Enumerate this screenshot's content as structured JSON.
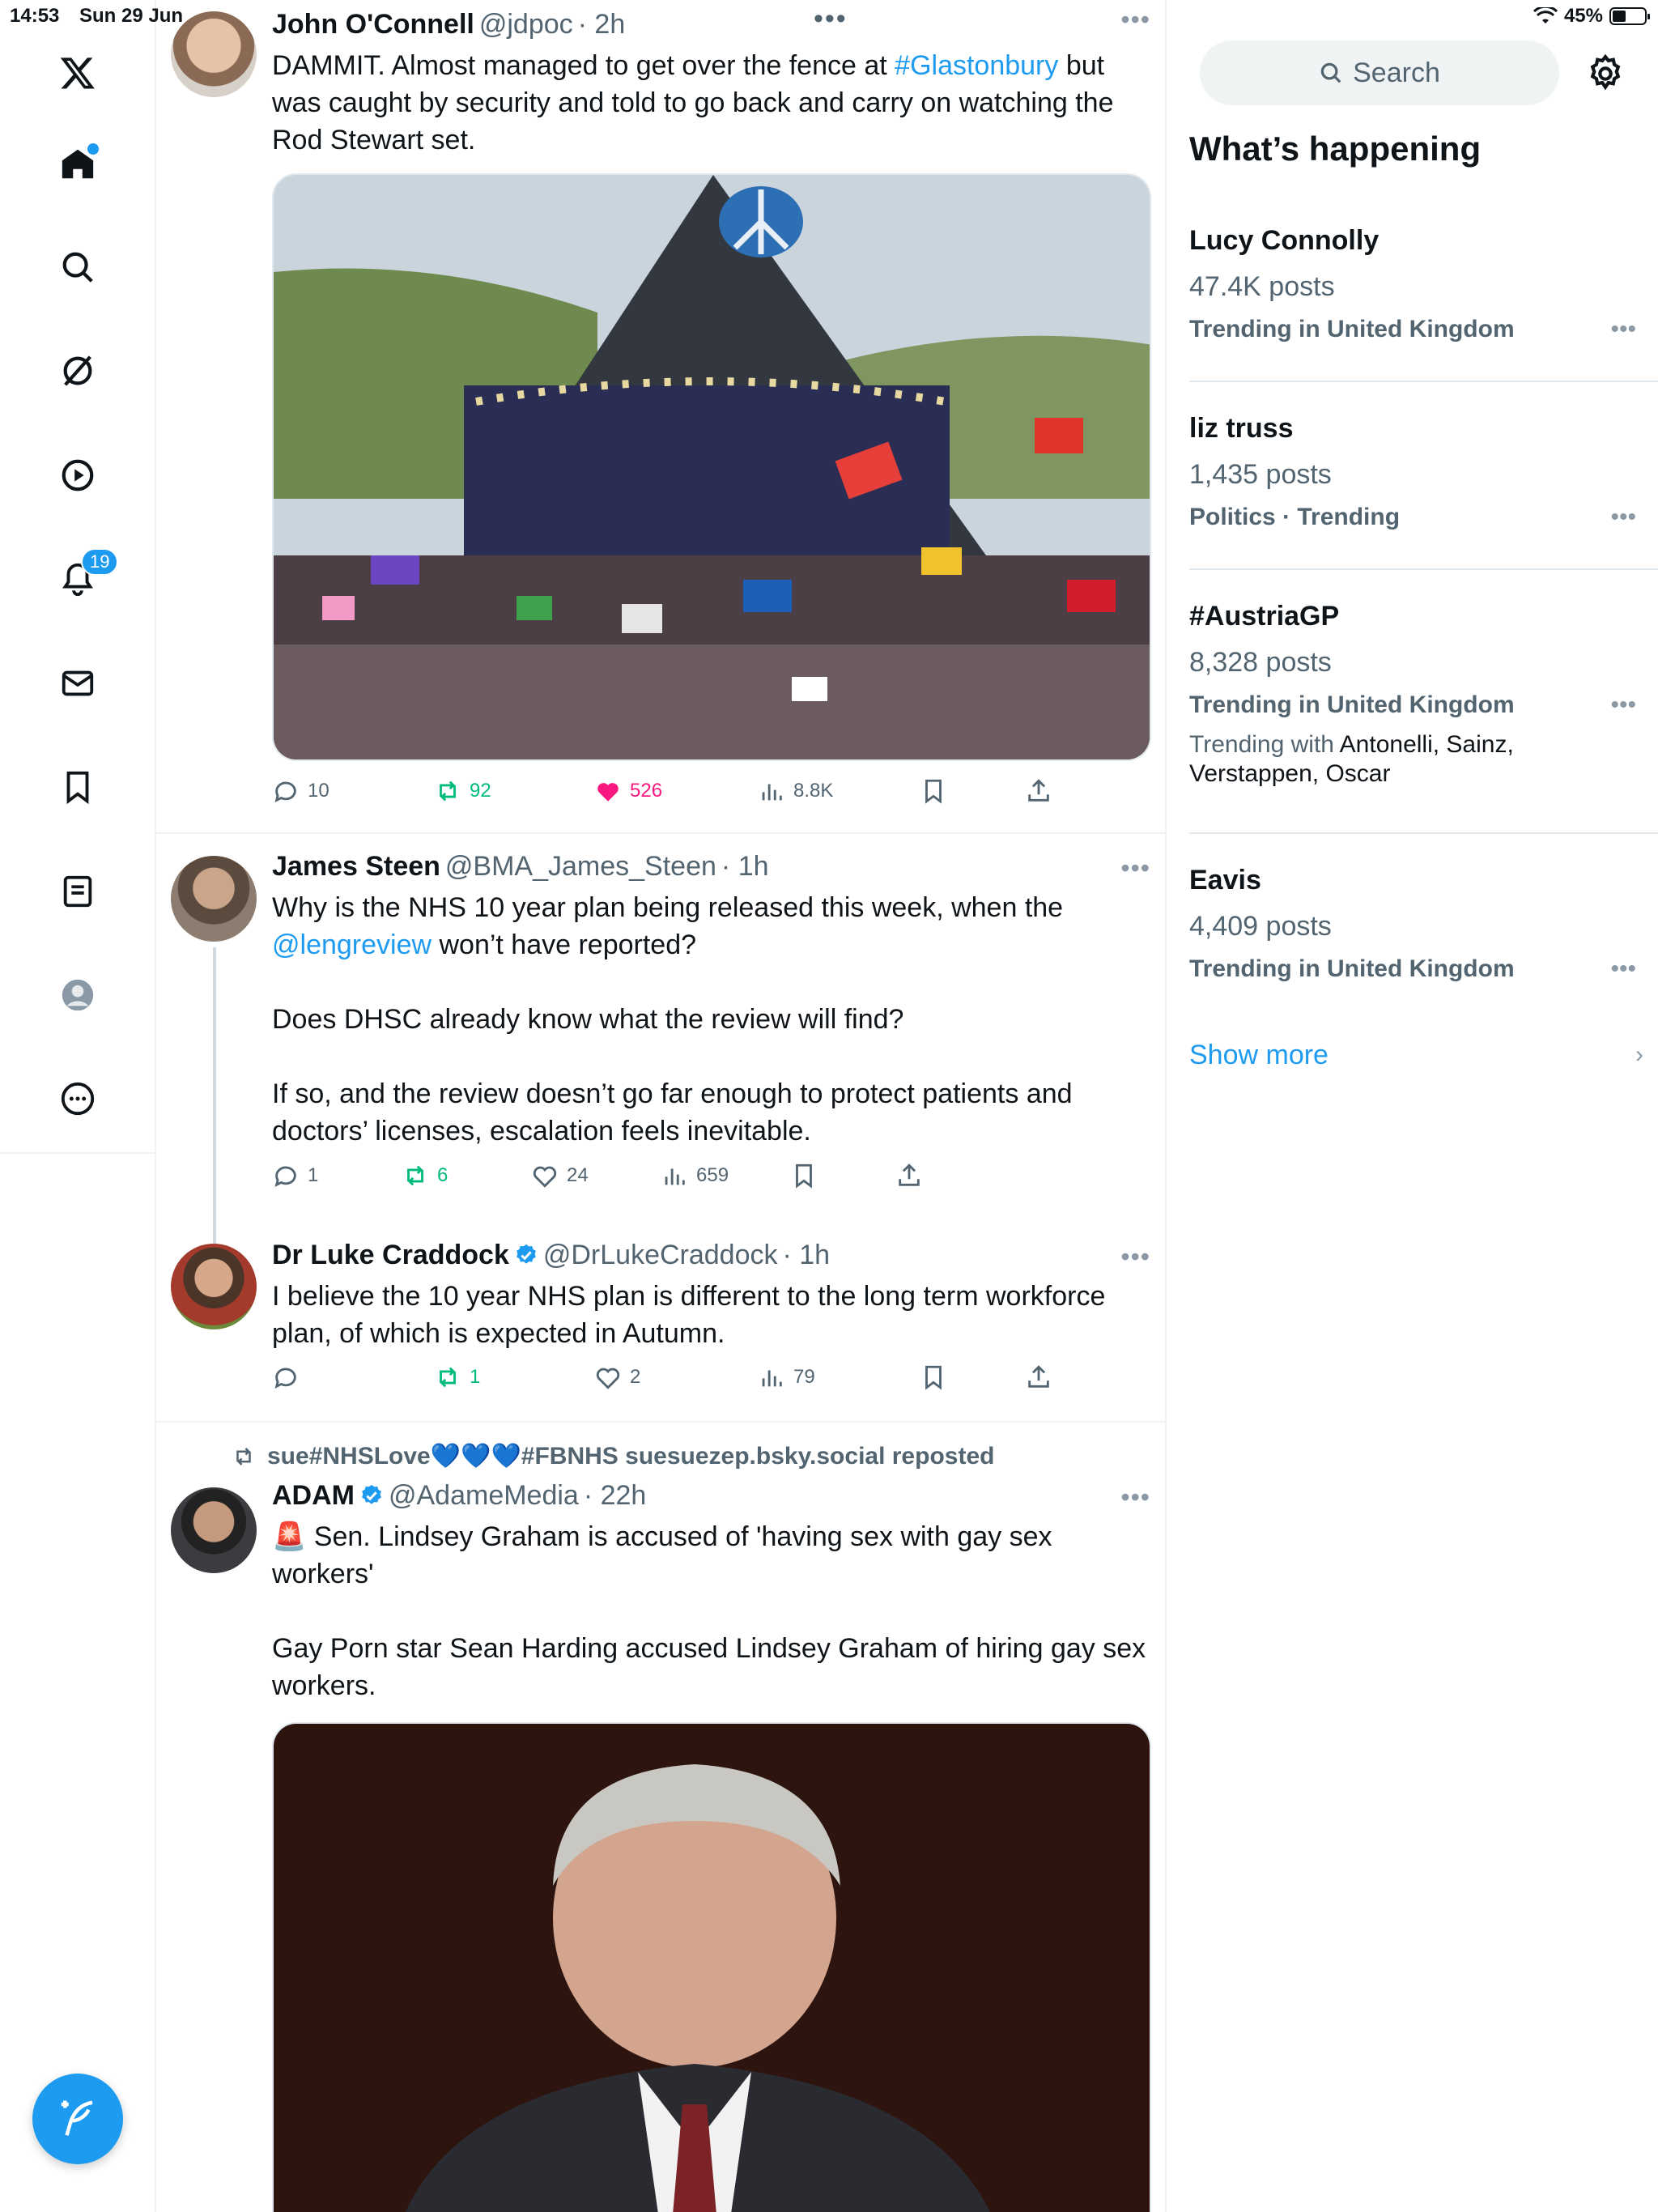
{
  "status_bar": {
    "time": "14:53",
    "date": "Sun 29 Jun",
    "battery": "45%",
    "battery_level": 0.45
  },
  "nav": {
    "notifications_badge": "19",
    "items": [
      "x-logo-icon",
      "home-icon",
      "search-icon",
      "grok-icon",
      "video-icon",
      "notifications-icon",
      "messages-icon",
      "bookmarks-icon",
      "lists-icon",
      "profile-icon",
      "more-icon"
    ]
  },
  "tweets": [
    {
      "name": "John O'Connell",
      "handle": "@jdpoc",
      "time": "· 2h",
      "text_before": "DAMMIT. Almost managed to get over the fence at ",
      "text_link": "#Glastonbury",
      "text_after": " but was caught by security and told to go back and carry on watching the Rod Stewart set.",
      "replies": "10",
      "reposts": "92",
      "likes": "526",
      "views": "8.8K"
    },
    {
      "name": "James Steen",
      "handle": "@BMA_James_Steen",
      "time": "· 1h",
      "text_line1": "Why is the NHS 10 year plan being released this week, when the",
      "text_link": "@lengreview",
      "text_line2": " won’t have reported?",
      "text_rest": "Does DHSC already know what the review will find?\n\nIf so, and the review doesn’t go far enough to protect patients and doctors’ licenses, escalation feels inevitable.",
      "replies": "1",
      "reposts": "6",
      "likes": "24",
      "views": "659"
    },
    {
      "name": "Dr Luke Craddock",
      "handle": "@DrLukeCraddock",
      "time": "· 1h",
      "text": "I believe the 10 year NHS plan is different to the long term workforce plan, of which is expected in Autumn.",
      "replies": "",
      "reposts": "1",
      "likes": "2",
      "views": "79"
    },
    {
      "repost_label": "sue#NHSLove💙💙💙#FBNHS suesuezep.bsky.social reposted",
      "name": "ADAM",
      "handle": "@AdameMedia",
      "time": "· 22h",
      "text": "🚨 Sen. Lindsey Graham is accused of 'having sex with gay sex workers'\n\nGay Porn star Sean Harding accused Lindsey Graham of hiring gay sex workers."
    }
  ],
  "sidebar": {
    "search_placeholder": "Search",
    "title": "What’s happening",
    "trends": [
      {
        "name": "Lucy Connolly",
        "count": "47.4K posts",
        "meta": "Trending in United Kingdom"
      },
      {
        "name": "liz truss",
        "count": "1,435 posts",
        "meta": "Politics · Trending"
      },
      {
        "name": "#AustriaGP",
        "count": "8,328 posts",
        "meta": "Trending in United Kingdom",
        "with_label": "Trending with",
        "with_names": " Antonelli, Sainz, Verstappen, Oscar"
      },
      {
        "name": "Eavis",
        "count": "4,409 posts",
        "meta": "Trending in United Kingdom"
      }
    ],
    "show_more": "Show more"
  },
  "colors": {
    "accent": "#1d9bf0",
    "repost": "#00ba7c",
    "like": "#f91880",
    "secondary_text": "#536471"
  }
}
